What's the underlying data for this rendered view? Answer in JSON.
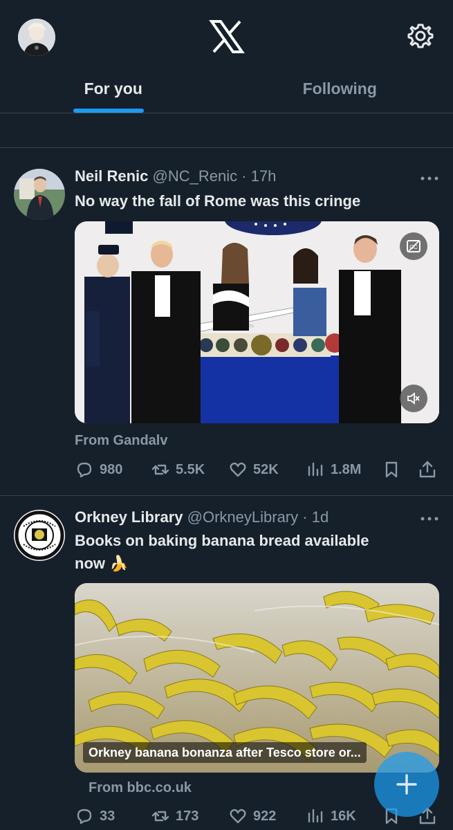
{
  "header": {
    "tabs": [
      {
        "label": "For you",
        "active": true
      },
      {
        "label": "Following",
        "active": false
      }
    ],
    "icons": {
      "logo": "x-logo-icon",
      "settings": "gear-icon"
    }
  },
  "tweets": [
    {
      "author_name": "Neil Renic",
      "handle": "@NC_Renic",
      "dot": "·",
      "time": "17h",
      "text": "No way the fall of Rome was this cringe",
      "from": "From Gandalv",
      "stats": {
        "replies": "980",
        "reposts": "5.5K",
        "likes": "52K",
        "views": "1.8M"
      }
    },
    {
      "author_name": "Orkney Library",
      "handle": "@OrkneyLibrary",
      "dot": "·",
      "time": "1d",
      "text_line1": "Books on baking banana bread available",
      "text_line2": "now 🍌",
      "link_caption": "Orkney banana bonanza after Tesco store or...",
      "from": "From bbc.co.uk",
      "stats": {
        "replies": "33",
        "reposts": "173",
        "likes": "922",
        "views": "16K"
      }
    }
  ],
  "colors": {
    "background": "#15202b",
    "accent": "#1d9bf0",
    "muted": "#8b98a5",
    "text": "#e7e9ea"
  }
}
